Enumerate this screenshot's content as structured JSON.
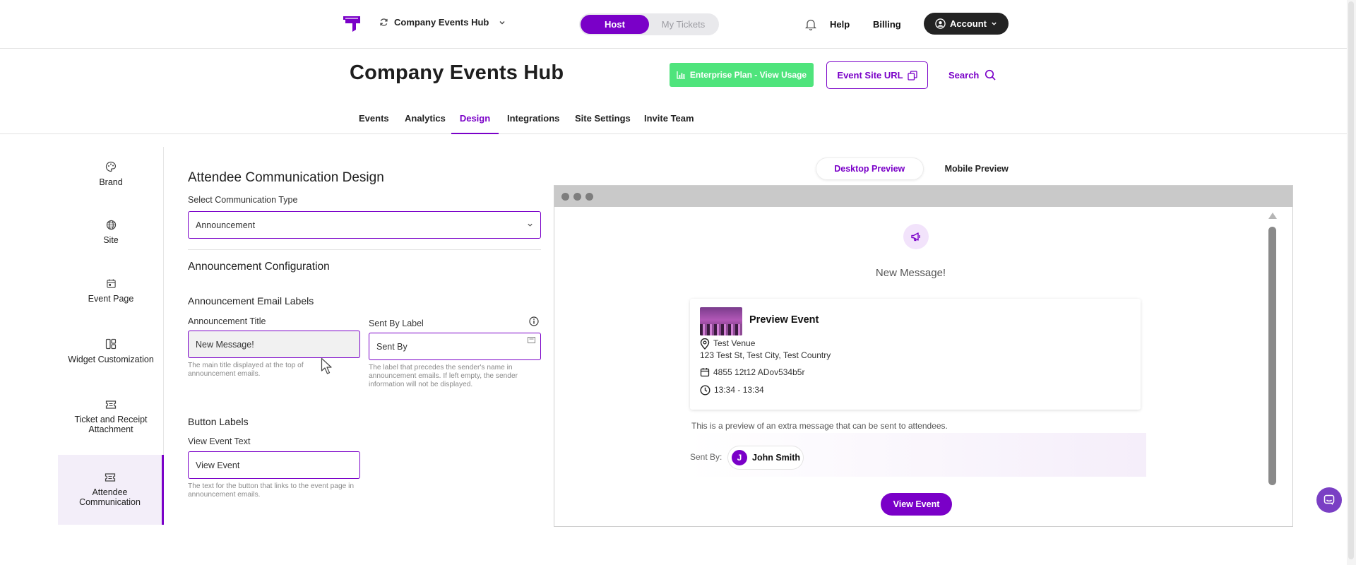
{
  "topbar": {
    "site_name": "Company Events Hub",
    "toggle": {
      "host": "Host",
      "tickets": "My Tickets",
      "active": "host"
    },
    "help": "Help",
    "billing": "Billing",
    "account": "Account"
  },
  "header": {
    "title": "Company Events Hub",
    "plan_button": "Enterprise Plan - View Usage",
    "url_button": "Event Site URL",
    "search": "Search"
  },
  "tabs": [
    {
      "label": "Events"
    },
    {
      "label": "Analytics"
    },
    {
      "label": "Design",
      "active": true
    },
    {
      "label": "Integrations"
    },
    {
      "label": "Site Settings"
    },
    {
      "label": "Invite Team"
    }
  ],
  "side_nav": [
    {
      "label": "Brand",
      "icon": "palette-icon"
    },
    {
      "label": "Site",
      "icon": "globe-icon"
    },
    {
      "label": "Event Page",
      "icon": "calendar-icon"
    },
    {
      "label": "Widget Customization",
      "icon": "widget-icon"
    },
    {
      "label": "Ticket and Receipt Attachment",
      "icon": "ticket-icon"
    },
    {
      "label": "Attendee Communication",
      "icon": "ticket-icon",
      "active": true
    }
  ],
  "form": {
    "heading": "Attendee Communication Design",
    "type_label": "Select Communication Type",
    "type_value": "Announcement",
    "config_heading": "Announcement Configuration",
    "email_labels_heading": "Announcement Email Labels",
    "title_label": "Announcement Title",
    "title_value": "New Message!",
    "title_help": "The main title displayed at the top of announcement emails.",
    "sentby_label": "Sent By Label",
    "sentby_value": "Sent By",
    "sentby_help": "The label that precedes the sender's name in announcement emails. If left empty, the sender information will not be displayed.",
    "button_labels_heading": "Button Labels",
    "view_event_label": "View Event Text",
    "view_event_value": "View Event",
    "view_event_help": "The text for the button that links to the event page in announcement emails."
  },
  "preview": {
    "desktop_tab": "Desktop Preview",
    "mobile_tab": "Mobile Preview",
    "active_tab": "desktop",
    "message_title": "New Message!",
    "event_name": "Preview Event",
    "venue": "Test Venue",
    "address": "123 Test St, Test City, Test Country",
    "date": "4855 12t12 ADov534b5r",
    "time": "13:34 - 13:34",
    "extra_message": "This is a preview of an extra message that can be sent to attendees.",
    "sent_by_label": "Sent By:",
    "sender_initial": "J",
    "sender_name": "John Smith",
    "button": "View Event"
  },
  "colors": {
    "accent": "#7a00c8",
    "plan_green": "#4fe47c",
    "account_dark": "#232323"
  }
}
